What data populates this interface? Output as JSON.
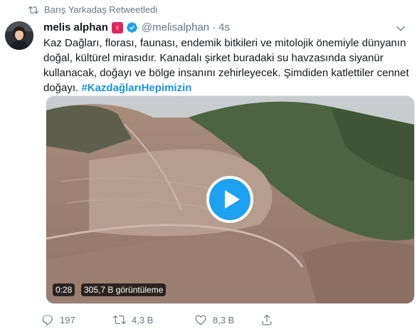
{
  "retweet_context": {
    "text": "Barış Yarkadaş Retweetledi",
    "icon": "retweet-icon"
  },
  "author": {
    "display_name": "melis alphan",
    "emoji": "♀",
    "emoji_color": "#e0245e",
    "verified": true,
    "handle": "@melisalphan",
    "separator": "·",
    "time": "4s"
  },
  "tweet": {
    "text": "Kaz Dağları, florası, faunası, endemik bitkileri ve mitolojik önemiyle dünyanın doğal, kültürel mirasıdır. Kanadalı şirket buradaki su havzasında siyanür kullanacak, doğayı ve bölge insanını zehirleyecek. Şimdiden katlettiler cennet doğayı.",
    "hashtag": "#KazdağlarıHepimizin"
  },
  "media": {
    "type": "video",
    "duration": "0:28",
    "views": "305,7 B görüntüleme",
    "play_color": "#1da1f2"
  },
  "actions": {
    "reply_count": "197",
    "retweet_count": "4,3 B",
    "like_count": "8,3 B"
  },
  "colors": {
    "link": "#1b95e0",
    "secondary_text": "#657786",
    "verified": "#1da1f2"
  }
}
